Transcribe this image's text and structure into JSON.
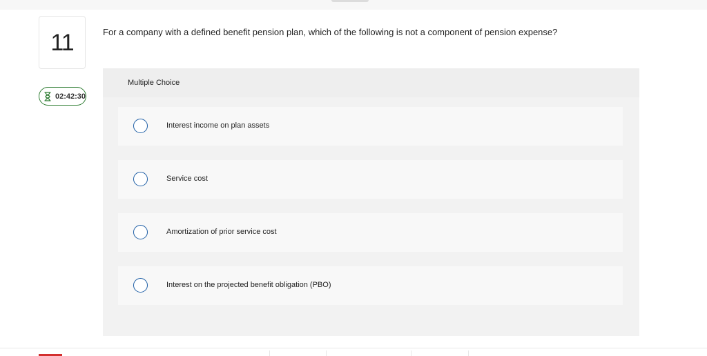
{
  "question": {
    "number": "11",
    "text": "For a company with a defined benefit pension plan, which of the following is not a component of pension expense?"
  },
  "timer": {
    "icon": "hourglass-icon",
    "value": "02:42:30"
  },
  "answer_panel": {
    "label": "Multiple Choice",
    "choices": [
      {
        "label": "Interest income on plan assets",
        "selected": false
      },
      {
        "label": "Service cost",
        "selected": false
      },
      {
        "label": "Amortization of prior service cost",
        "selected": false
      },
      {
        "label": "Interest on the projected benefit obligation (PBO)",
        "selected": false
      }
    ]
  },
  "colors": {
    "radio_border": "#1f5fa6",
    "timer_border": "#2e7d32",
    "accent_red": "#d32f2f"
  }
}
